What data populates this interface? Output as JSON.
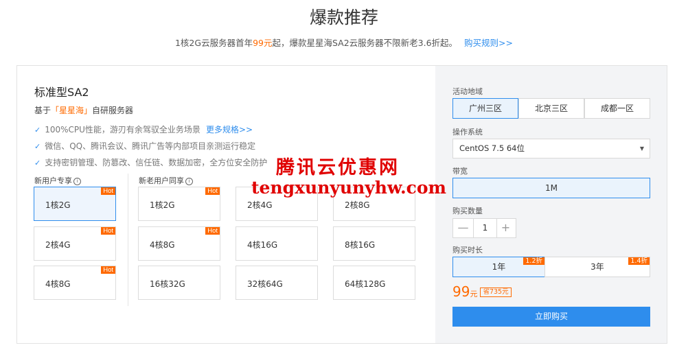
{
  "header": {
    "title": "爆款推荐",
    "subtitle_pre": "1核2G云服务器首年",
    "subtitle_price": "99元",
    "subtitle_post": "起，爆款星星海SA2云服务器不限新老3.6折起。",
    "rules_link": "购买规则>>"
  },
  "product": {
    "name": "标准型SA2",
    "desc_pre": "基于",
    "desc_brand": "「星星海」",
    "desc_post": "自研服务器",
    "features": [
      {
        "text": "100%CPU性能，游刃有余驾驭全业务场景",
        "link": "更多规格>>"
      },
      {
        "text": "微信、QQ、腾讯会议、腾讯广告等内部项目亲测运行稳定",
        "link": ""
      },
      {
        "text": "支持密钥管理、防篡改、信任链、数据加密，全方位安全防护",
        "link": ""
      }
    ]
  },
  "groups": {
    "new_label": "新用户专享",
    "all_label": "新老用户同享",
    "hot_label": "Hot",
    "info_glyph": "i"
  },
  "specs_new": [
    {
      "label": "1核2G",
      "hot": true,
      "selected": true
    },
    {
      "label": "2核4G",
      "hot": true,
      "selected": false
    },
    {
      "label": "4核8G",
      "hot": true,
      "selected": false
    }
  ],
  "specs_all": [
    {
      "label": "1核2G",
      "hot": true
    },
    {
      "label": "2核4G",
      "hot": false
    },
    {
      "label": "2核8G",
      "hot": false
    },
    {
      "label": "4核8G",
      "hot": true
    },
    {
      "label": "4核16G",
      "hot": false
    },
    {
      "label": "8核16G",
      "hot": false
    },
    {
      "label": "16核32G",
      "hot": false
    },
    {
      "label": "32核64G",
      "hot": false
    },
    {
      "label": "64核128G",
      "hot": false
    }
  ],
  "watermark": {
    "cn": "腾讯云优惠网",
    "en": "tengxunyunyhw.com"
  },
  "config": {
    "region_label": "活动地域",
    "regions": [
      {
        "label": "广州三区",
        "selected": true
      },
      {
        "label": "北京三区",
        "selected": false
      },
      {
        "label": "成都一区",
        "selected": false
      }
    ],
    "os_label": "操作系统",
    "os_value": "CentOS 7.5 64位",
    "bandwidth_label": "带宽",
    "bandwidth_value": "1M",
    "qty_label": "购买数量",
    "qty_value": "1",
    "qty_minus": "—",
    "qty_plus": "+",
    "duration_label": "购买时长",
    "durations": [
      {
        "label": "1年",
        "discount": "1.2折",
        "selected": true
      },
      {
        "label": "3年",
        "discount": "1.4折",
        "selected": false
      }
    ],
    "price": "99",
    "price_unit": "元",
    "saving": "省735元",
    "buy_label": "立即购买"
  },
  "colors": {
    "accent": "#2e8ded",
    "highlight": "#ff6a00",
    "watermark": "#e00000"
  }
}
